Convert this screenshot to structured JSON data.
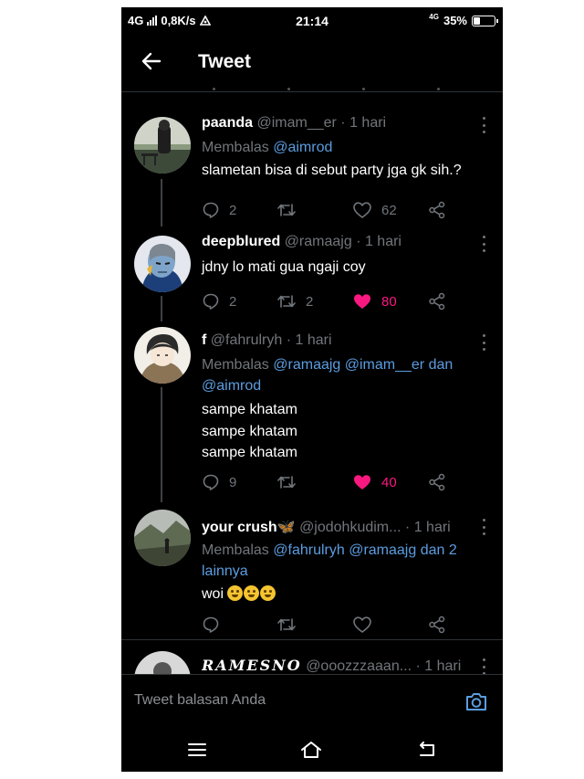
{
  "status_bar": {
    "network": "4G",
    "speed": "0,8K/s",
    "time": "21:14",
    "network_right": "4G",
    "battery": "35%",
    "battery_level": 0.35
  },
  "header": {
    "title": "Tweet"
  },
  "tweets": [
    {
      "name": "paanda",
      "handle": "@imam__er",
      "time": "· 1 hari",
      "reply_prefix": "Membalas",
      "reply_to": "@aimrod",
      "body": [
        "slametan bisa di sebut party jga gk sih.?"
      ],
      "replies": "2",
      "retweets": "",
      "likes": "62",
      "liked": false
    },
    {
      "name": "deepblured",
      "handle": "@ramaajg",
      "time": "· 1 hari",
      "body": [
        "jdny lo mati gua ngaji coy"
      ],
      "replies": "2",
      "retweets": "2",
      "likes": "80",
      "liked": true
    },
    {
      "name": "f",
      "handle": "@fahrulryh",
      "time": "· 1 hari",
      "reply_prefix": "Membalas",
      "reply_to_line1": "@ramaajg @imam__er dan",
      "reply_to_line2": "@aimrod",
      "body": [
        "sampe khatam",
        "sampe khatam",
        "sampe khatam"
      ],
      "replies": "9",
      "retweets": "",
      "likes": "40",
      "liked": true
    },
    {
      "name": "your crush🦋",
      "handle": "@jodohkudim...",
      "time": "· 1 hari",
      "reply_prefix": "Membalas",
      "reply_to_line1": "@fahrulryh @ramaajg dan 2",
      "reply_to_line2": "lainnya",
      "body": [
        "woi"
      ],
      "replies": "",
      "retweets": "",
      "likes": "",
      "liked": false
    },
    {
      "name": "RAMESNO",
      "handle": "@ooozzzaaan...",
      "time": "· 1 hari"
    }
  ],
  "compose": {
    "placeholder": "Tweet balasan Anda"
  },
  "colors": {
    "background": "#000000",
    "mention": "#5b9de0",
    "like": "#f91880",
    "muted": "#71767b"
  },
  "icons": [
    "back-arrow-icon",
    "reply-icon",
    "retweet-icon",
    "heart-icon",
    "share-icon",
    "more-icon",
    "camera-icon",
    "menu-icon",
    "home-icon",
    "back-nav-icon"
  ]
}
